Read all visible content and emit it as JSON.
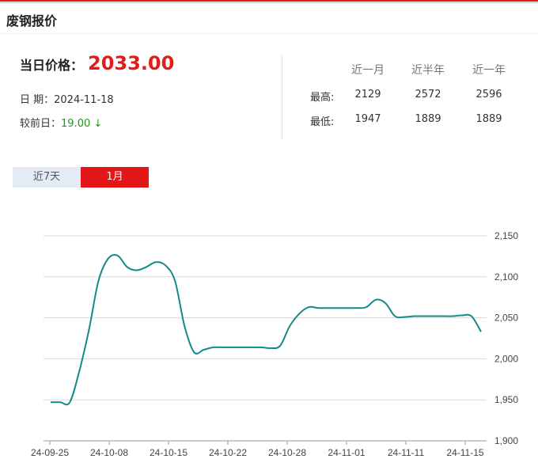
{
  "header": {
    "title": "废钢报价"
  },
  "price": {
    "label": "当日价格：",
    "value": "2033.00"
  },
  "date": {
    "label": "日 期：",
    "value": "2024-11-18"
  },
  "change": {
    "label": "较前日：",
    "value": "19.00",
    "arrow": "↓"
  },
  "stats": {
    "columns": [
      "近一月",
      "近半年",
      "近一年"
    ],
    "high_label": "最高:",
    "low_label": "最低:",
    "high": [
      "2129",
      "2572",
      "2596"
    ],
    "low": [
      "1947",
      "1889",
      "1889"
    ]
  },
  "tabs": [
    {
      "label": "近7天",
      "active": false
    },
    {
      "label": "1月",
      "active": true
    }
  ],
  "colors": {
    "accent": "#e31717",
    "line": "#138a8a",
    "up_down": "#1a9a1a"
  },
  "chart_data": {
    "type": "line",
    "x_ticks": [
      "24-09-25",
      "24-10-08",
      "24-10-15",
      "24-10-22",
      "24-10-28",
      "24-11-01",
      "24-11-11",
      "24-11-15"
    ],
    "y_ticks": [
      "2,150",
      "2,100",
      "2,050",
      "2,000",
      "1,950",
      "1,900"
    ],
    "ylim": [
      1900,
      2150
    ],
    "grid": true,
    "series": [
      {
        "values": [
          1947,
          1947,
          1947,
          1985,
          2035,
          2095,
          2122,
          2126,
          2112,
          2108,
          2112,
          2118,
          2114,
          2095,
          2040,
          2008,
          2011,
          2014,
          2014,
          2014,
          2014,
          2014,
          2014,
          2013,
          2016,
          2040,
          2055,
          2063,
          2062,
          2062,
          2062,
          2062,
          2062,
          2063,
          2072,
          2068,
          2052,
          2051,
          2052,
          2052,
          2052,
          2052,
          2052,
          2053,
          2052,
          2033
        ]
      }
    ]
  }
}
